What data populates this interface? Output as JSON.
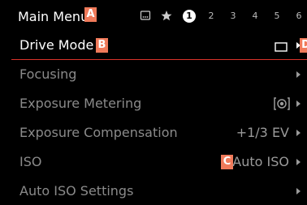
{
  "header": {
    "title": "Main Menu",
    "marker_title": "A",
    "tabs": {
      "icons": [
        "memory-card-icon",
        "star-icon"
      ],
      "pages": [
        "2",
        "3",
        "4",
        "5",
        "6"
      ],
      "active_page": "1"
    }
  },
  "menu": {
    "items": [
      {
        "label": "Drive Mode",
        "marker": "B",
        "value_icon": "single-frame-icon",
        "edge_marker": "D",
        "selected": true
      },
      {
        "label": "Focusing"
      },
      {
        "label": "Exposure Metering",
        "value_icon": "spot-metering-icon"
      },
      {
        "label": "Exposure Compensation",
        "value": "+1/3 EV"
      },
      {
        "label": "ISO",
        "marker": "C",
        "value": "Auto ISO"
      },
      {
        "label": "Auto ISO Settings"
      }
    ]
  },
  "colors": {
    "background": "#000000",
    "selected_text": "#ffffff",
    "text": "#8a8a8a",
    "accent_line": "#d9322a",
    "marker": "#f07a5a"
  }
}
